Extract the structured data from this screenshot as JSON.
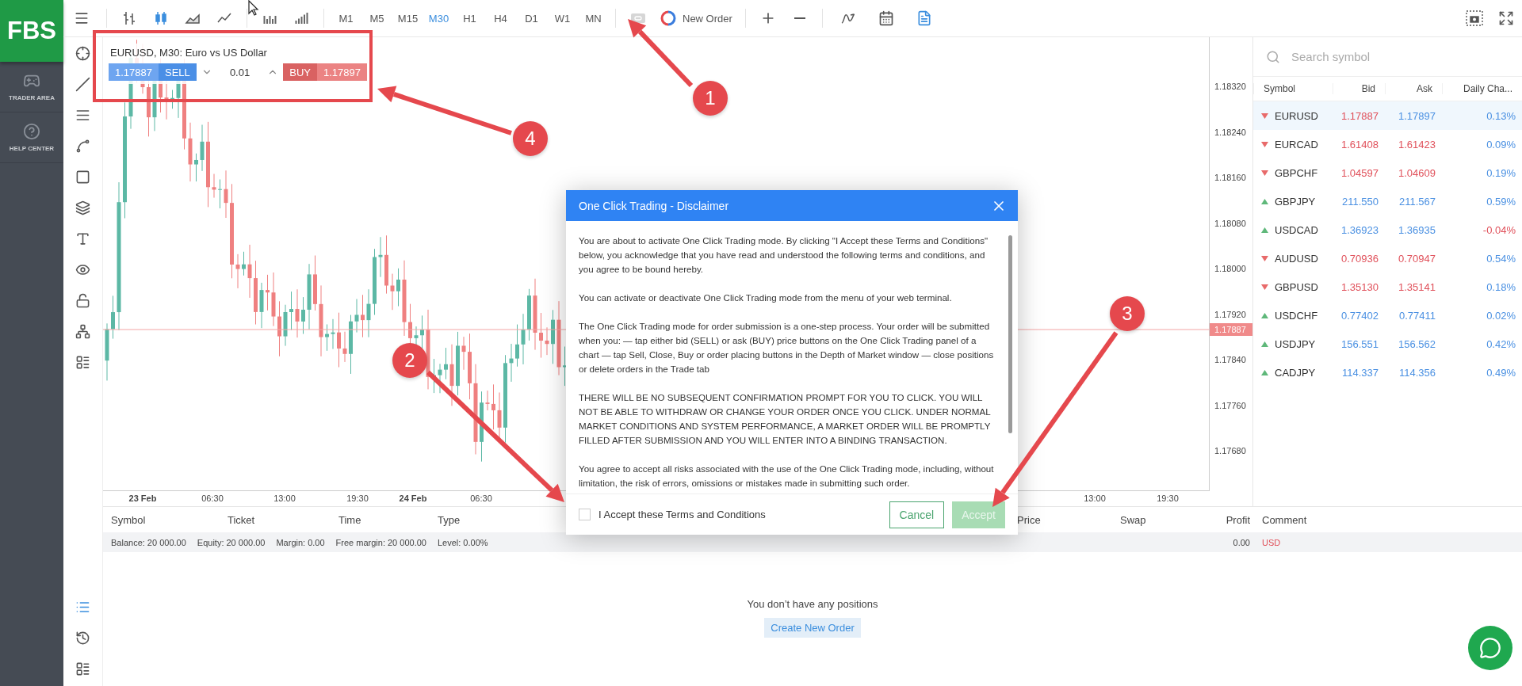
{
  "sidebar": {
    "logo": "FBS",
    "items": [
      {
        "label": "TRADER AREA",
        "kind": "gamepad"
      },
      {
        "label": "HELP CENTER",
        "kind": "help"
      }
    ]
  },
  "toolbar": {
    "chart_types": [
      {
        "kind": "bars",
        "selected": false
      },
      {
        "kind": "candles",
        "selected": true
      },
      {
        "kind": "area",
        "selected": false
      },
      {
        "kind": "line",
        "selected": false
      }
    ],
    "timeframes": [
      {
        "label": "M1",
        "selected": false
      },
      {
        "label": "M5",
        "selected": false
      },
      {
        "label": "M15",
        "selected": false
      },
      {
        "label": "M30",
        "selected": true
      },
      {
        "label": "H1",
        "selected": false
      },
      {
        "label": "H4",
        "selected": false
      },
      {
        "label": "D1",
        "selected": false
      },
      {
        "label": "W1",
        "selected": false
      },
      {
        "label": "MN",
        "selected": false
      }
    ],
    "one_click_enabled": false,
    "new_order": "New Order",
    "panels": [
      {
        "kind": "indicators",
        "selected": false
      },
      {
        "kind": "calendar",
        "selected": false
      },
      {
        "kind": "document",
        "selected": true
      }
    ]
  },
  "order_panel": {
    "title": "EURUSD, M30: Euro vs US Dollar",
    "sell_price": "1.17887",
    "sell_label": "SELL",
    "volume": "0.01",
    "buy_label": "BUY",
    "buy_price": "1.17897"
  },
  "chart": {
    "price_ticks": [
      "1.18320",
      "1.18240",
      "1.18160",
      "1.18080",
      "1.18000",
      "1.17920",
      "1.17840",
      "1.17760",
      "1.17680"
    ],
    "current_price": "1.17887",
    "time_labels": [
      {
        "label": "23 Feb",
        "kind": "day"
      },
      {
        "label": "06:30",
        "kind": "time"
      },
      {
        "label": "13:00",
        "kind": "time"
      },
      {
        "label": "19:30",
        "kind": "time"
      },
      {
        "label": "24 Feb",
        "kind": "day"
      },
      {
        "label": "06:30",
        "kind": "time"
      },
      {
        "label": "13:00",
        "kind": "time"
      },
      {
        "label": "19:30",
        "kind": "time"
      }
    ]
  },
  "watchlist": {
    "search_placeholder": "Search symbol",
    "columns": [
      "Symbol",
      "Bid",
      "Ask",
      "Daily Cha..."
    ],
    "rows": [
      {
        "symbol": "EURUSD",
        "bid": "1.17887",
        "ask": "1.17897",
        "change": "0.13%",
        "falling": true,
        "ask_falling": false,
        "change_negative": false,
        "selected": true
      },
      {
        "symbol": "EURCAD",
        "bid": "1.61408",
        "ask": "1.61423",
        "change": "0.09%",
        "falling": true,
        "ask_falling": true,
        "change_negative": false,
        "selected": false
      },
      {
        "symbol": "GBPCHF",
        "bid": "1.04597",
        "ask": "1.04609",
        "change": "0.19%",
        "falling": true,
        "ask_falling": true,
        "change_negative": false,
        "selected": false
      },
      {
        "symbol": "GBPJPY",
        "bid": "211.550",
        "ask": "211.567",
        "change": "0.59%",
        "falling": false,
        "ask_falling": false,
        "change_negative": false,
        "selected": false
      },
      {
        "symbol": "USDCAD",
        "bid": "1.36923",
        "ask": "1.36935",
        "change": "-0.04%",
        "falling": false,
        "ask_falling": false,
        "change_negative": true,
        "selected": false
      },
      {
        "symbol": "AUDUSD",
        "bid": "0.70936",
        "ask": "0.70947",
        "change": "0.54%",
        "falling": true,
        "ask_falling": true,
        "change_negative": false,
        "selected": false
      },
      {
        "symbol": "GBPUSD",
        "bid": "1.35130",
        "ask": "1.35141",
        "change": "0.18%",
        "falling": true,
        "ask_falling": true,
        "change_negative": false,
        "selected": false
      },
      {
        "symbol": "USDCHF",
        "bid": "0.77402",
        "ask": "0.77411",
        "change": "0.02%",
        "falling": false,
        "ask_falling": false,
        "change_negative": false,
        "selected": false
      },
      {
        "symbol": "USDJPY",
        "bid": "156.551",
        "ask": "156.562",
        "change": "0.42%",
        "falling": false,
        "ask_falling": false,
        "change_negative": false,
        "selected": false
      },
      {
        "symbol": "CADJPY",
        "bid": "114.337",
        "ask": "114.356",
        "change": "0.49%",
        "falling": false,
        "ask_falling": false,
        "change_negative": false,
        "selected": false
      }
    ]
  },
  "positions": {
    "columns": [
      "Symbol",
      "Ticket",
      "Time",
      "Type",
      "Price",
      "Swap",
      "Profit",
      "Comment"
    ],
    "summary": [
      "Balance: 20 000.00",
      "Equity: 20 000.00",
      "Margin: 0.00",
      "Free margin: 20 000.00",
      "Level: 0.00%"
    ],
    "profit": "0.00",
    "currency": "USD",
    "empty_message": "You don’t have any positions",
    "create_button": "Create New Order",
    "tabs": [
      {
        "kind": "positions",
        "selected": true
      },
      {
        "kind": "history",
        "selected": false
      },
      {
        "kind": "journal",
        "selected": false
      }
    ]
  },
  "dialog": {
    "title": "One Click Trading - Disclaimer",
    "paragraphs": [
      "You are about to activate One Click Trading mode. By clicking \"I Accept these Terms and Conditions\" below, you acknowledge that you have read and understood the following terms and conditions, and you agree to be bound hereby.",
      "You can activate or deactivate One Click Trading mode from the menu of your web terminal.",
      "The One Click Trading mode for order submission is a one-step process. Your order will be submitted when you: — tap either bid (SELL) or ask (BUY) price buttons on the One Click Trading panel of a chart — tap Sell, Close, Buy or order placing buttons in the Depth of Market window — close positions or delete orders in the Trade tab",
      "THERE WILL BE NO SUBSEQUENT CONFIRMATION PROMPT FOR YOU TO CLICK. YOU WILL NOT BE ABLE TO WITHDRAW OR CHANGE YOUR ORDER ONCE YOU CLICK. UNDER NORMAL MARKET CONDITIONS AND SYSTEM PERFORMANCE, A MARKET ORDER WILL BE PROMPTLY FILLED AFTER SUBMISSION AND YOU WILL ENTER INTO A BINDING TRANSACTION.",
      "You agree to accept all risks associated with the use of the One Click Trading mode, including, without limitation, the risk of errors, omissions or mistakes made in submitting such order."
    ],
    "checkbox_label": "I Accept these Terms and Conditions",
    "checked": false,
    "cancel": "Cancel",
    "accept": "Accept",
    "accept_disabled": true
  },
  "annotations": [
    {
      "label": "1"
    },
    {
      "label": "2"
    },
    {
      "label": "3"
    },
    {
      "label": "4"
    }
  ]
}
